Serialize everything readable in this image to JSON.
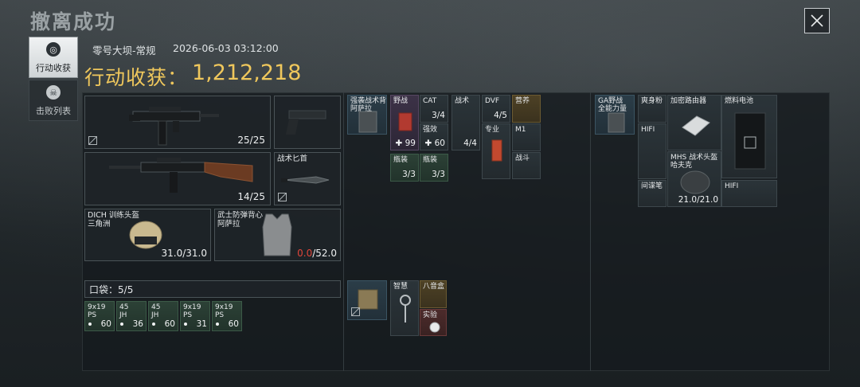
{
  "header": {
    "title": "撤离成功",
    "map_mode": "零号大坝-常规",
    "timestamp": "2026-06-03 03:12:00",
    "earnings_label": "行动收获：",
    "earnings_value": "1,212,218"
  },
  "sidebar": {
    "tabs": [
      {
        "label": "行动收获",
        "icon": "target-icon",
        "active": true
      },
      {
        "label": "击败列表",
        "icon": "skull-icon",
        "active": false
      }
    ]
  },
  "loadout": {
    "primary_weapon_ammo": "25/25",
    "secondary_weapon_ammo": "14/25",
    "pistol_label": "",
    "melee_label": "战术匕首",
    "helmet": {
      "name": "DICH 训练头盔",
      "sub": "三角洲",
      "durability": "31.0/31.0"
    },
    "armor": {
      "name": "武士防弹背心",
      "sub": "阿萨拉",
      "durability_current": "0.0",
      "durability_max": "/52.0"
    }
  },
  "pocket": {
    "label": "口袋：",
    "capacity": "5/5",
    "items": [
      {
        "line1": "9x19",
        "line2": "PS",
        "count": "60"
      },
      {
        "line1": "45",
        "line2": "JH",
        "count": "36"
      },
      {
        "line1": "45",
        "line2": "JH",
        "count": "60"
      },
      {
        "line1": "9x19",
        "line2": "PS",
        "count": "31"
      },
      {
        "line1": "9x19",
        "line2": "PS",
        "count": "60"
      }
    ]
  },
  "chest_rig": {
    "items": [
      {
        "label": "强袭战术背心",
        "sub": "阿萨拉"
      },
      {
        "label": "野战",
        "count": "99"
      },
      {
        "label": "CAT",
        "count": "3/4"
      },
      {
        "label": "强效",
        "count": "60"
      },
      {
        "label": "战术",
        "count": "4/4"
      },
      {
        "label": "DVF",
        "count": "4/5"
      },
      {
        "label": "专业",
        "count": ""
      },
      {
        "label": "营养",
        "count": ""
      },
      {
        "label": "M1",
        "count": ""
      },
      {
        "label": "战斗",
        "count": ""
      },
      {
        "label": "瓶装",
        "count": "3/3"
      },
      {
        "label": "瓶装",
        "count": "3/3"
      }
    ]
  },
  "backpack_small": {
    "items": [
      {
        "label": "智慧",
        "count": ""
      },
      {
        "label": "八音盒",
        "count": ""
      },
      {
        "label": "实验",
        "count": ""
      }
    ]
  },
  "backpack": {
    "items": [
      {
        "label": "GA野战",
        "sub": "全能力量"
      },
      {
        "label": "爽身粉"
      },
      {
        "label": "HIFI"
      },
      {
        "label": "加密路由器"
      },
      {
        "label": "燃料电池"
      },
      {
        "label": "MHS 战术头盔",
        "sub": "哈夫克",
        "durability": "21.0/21.0"
      },
      {
        "label": "间谍笔"
      },
      {
        "label": "HIFI"
      }
    ]
  },
  "colors": {
    "accent_gold": "#efc75c",
    "damage_red": "#e0453a"
  }
}
